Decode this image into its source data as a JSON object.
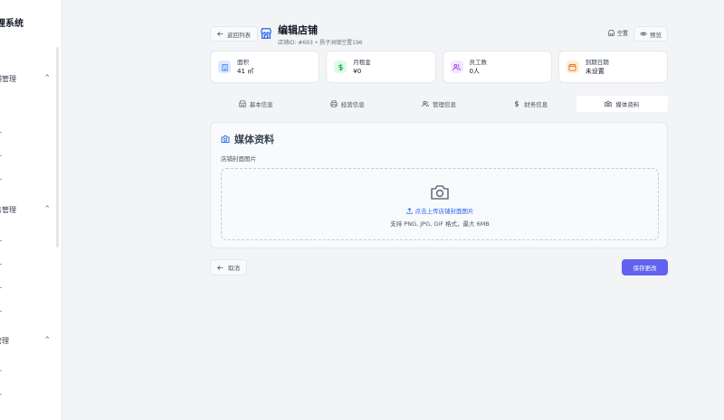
{
  "sidebar": {
    "brand": "理系统",
    "groups": [
      {
        "label": "铺管理"
      },
      {
        "label": "务管理"
      },
      {
        "label": "管理"
      }
    ]
  },
  "header": {
    "back_label": "返回列表",
    "title": "编辑店铺",
    "subtitle": "店铺ID: #693 • 扬子洲镇空置196",
    "status_label": "空置",
    "preview_label": "预览"
  },
  "stats": [
    {
      "label": "面积",
      "value": "41 ㎡",
      "icon": "building-icon",
      "color": "#3b82f6",
      "bg": "#dbeafe"
    },
    {
      "label": "月租金",
      "value": "¥0",
      "icon": "dollar-icon",
      "color": "#16a34a",
      "bg": "#dcfce7"
    },
    {
      "label": "员工数",
      "value": "0人",
      "icon": "users-icon",
      "color": "#9333ea",
      "bg": "#f3e8ff"
    },
    {
      "label": "到期日期",
      "value": "未设置",
      "icon": "calendar-icon",
      "color": "#ea580c",
      "bg": "#ffedd5"
    }
  ],
  "tabs": [
    {
      "label": "基本信息",
      "icon": "store-icon"
    },
    {
      "label": "经营信息",
      "icon": "printer-icon"
    },
    {
      "label": "管理信息",
      "icon": "users-icon"
    },
    {
      "label": "财务信息",
      "icon": "dollar-icon"
    },
    {
      "label": "媒体资料",
      "icon": "camera-icon",
      "active": true
    }
  ],
  "media": {
    "title": "媒体资料",
    "field_label": "店铺封面图片",
    "upload_link": "点击上传店铺封面图片",
    "upload_hint": "支持 PNG, JPG, GIF 格式，最大 6MB"
  },
  "actions": {
    "cancel_label": "取消",
    "save_label": "保存更改"
  },
  "colors": {
    "accent": "#5b5bf0",
    "link": "#2563eb",
    "brand_icon": "#2563eb"
  }
}
